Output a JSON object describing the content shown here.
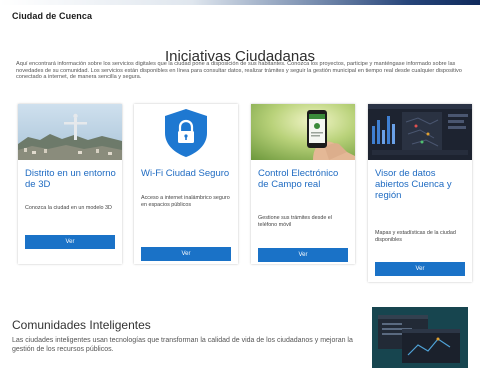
{
  "header": {
    "brand": "Ciudad de Cuenca"
  },
  "hero": {
    "title": "Iniciativas Ciudadanas",
    "intro": "Aquí encontrará información sobre los servicios digitales que la ciudad pone a disposición de sus habitantes. Conozca los proyectos, participe y manténgase informado sobre las novedades de su comunidad. Los servicios están disponibles en línea para consultar datos, realizar trámites y seguir la gestión municipal en tiempo real desde cualquier dispositivo conectado a internet, de manera sencilla y segura."
  },
  "cards": [
    {
      "title": "Distrito en un entorno de 3D",
      "description": "Conozca la ciudad en un modelo 3D",
      "button_label": "Ver",
      "image_icon": "city-statue-photo"
    },
    {
      "title": "Wi-Fi Ciudad Seguro",
      "description": "Acceso a internet inalámbrico seguro en espacios públicos",
      "button_label": "Ver",
      "image_icon": "shield-lock-icon"
    },
    {
      "title": "Control Electrónico de Campo real",
      "description": "Gestione sus trámites desde el teléfono móvil",
      "button_label": "Ver",
      "image_icon": "smartphone-photo"
    },
    {
      "title": "Visor de datos abiertos Cuenca y región",
      "description": "Mapas y estadísticas de la ciudad disponibles",
      "button_label": "Ver",
      "image_icon": "dashboard-screenshot"
    }
  ],
  "section": {
    "title": "Comunidades Inteligentes",
    "text": "Las ciudades inteligentes usan tecnologías que transforman la calidad de vida de los ciudadanos y mejoran la gestión de los recursos públicos."
  },
  "colors": {
    "accent": "#1a72c7",
    "title_blue": "#1f6bc2"
  }
}
